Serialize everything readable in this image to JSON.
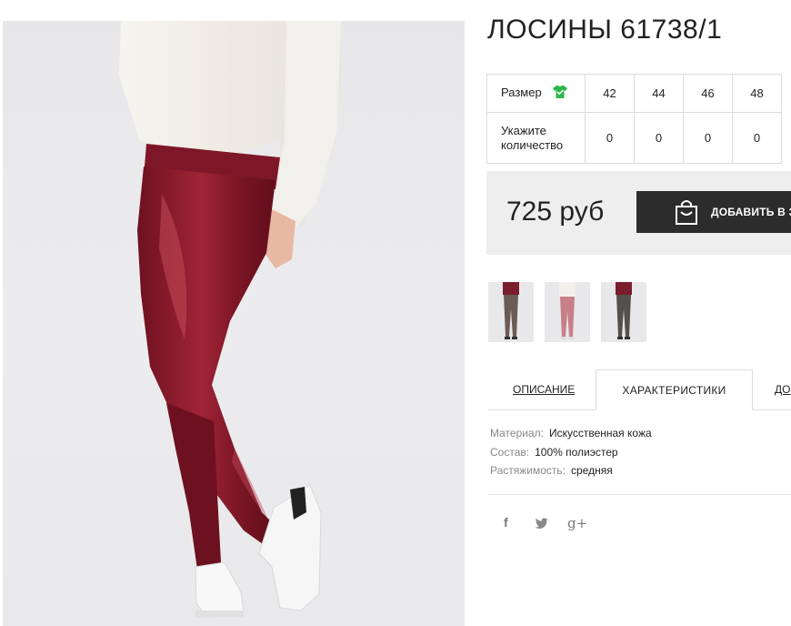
{
  "product": {
    "title": "ЛОСИНЫ 61738/1",
    "image_alt": "photo of model in burgundy faux-leather leggings, white sweater and white sneakers"
  },
  "sizes": {
    "label": "Размер",
    "icon": "t-shirt-check-icon",
    "icon_color": "#2db84c",
    "values": [
      "42",
      "44",
      "46",
      "48"
    ],
    "quantity_label": "Укажите количество",
    "quantities": [
      "0",
      "0",
      "0",
      "0"
    ]
  },
  "buy": {
    "price": "725 руб",
    "button_label": "ДОБАВИТЬ В З",
    "button_icon": "shopping-bag-icon"
  },
  "thumbnails": [
    {
      "color": "burgundy"
    },
    {
      "color": "pink"
    },
    {
      "color": "gray"
    }
  ],
  "tabs": [
    {
      "label": "ОПИСАНИЕ"
    },
    {
      "label": "ХАРАКТЕРИСТИКИ",
      "active": true
    },
    {
      "label": "ДО"
    }
  ],
  "specs": [
    {
      "key": "Материал:",
      "value": "Искусственная кожа"
    },
    {
      "key": "Состав:",
      "value": "100% полиэстер"
    },
    {
      "key": "Растяжимость:",
      "value": "средняя"
    }
  ],
  "social": [
    {
      "icon": "facebook-icon",
      "glyph": "f"
    },
    {
      "icon": "twitter-icon"
    },
    {
      "icon": "google-plus-icon",
      "glyph": "g+"
    }
  ],
  "colors": {
    "accent_dark": "#2c2c2c",
    "panel_bg": "#eeeeee",
    "leggings": "#8b1d2c"
  }
}
